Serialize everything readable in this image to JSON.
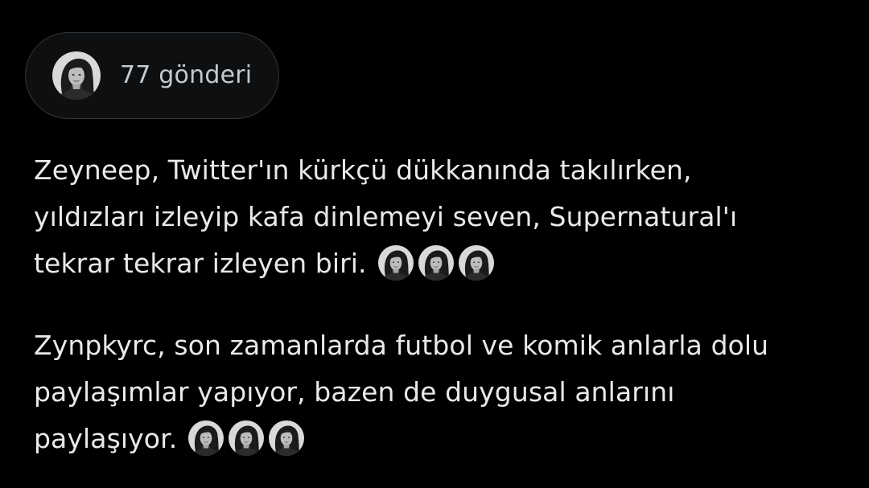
{
  "post_count_pill": {
    "label": "77 gönderi"
  },
  "paragraphs": [
    {
      "lines": [
        "Zeyneep, Twitter'ın kürkçü dükkanında takılırken,",
        "yıldızları izleyip kafa dinlemeyi seven, Supernatural'ı",
        "tekrar tekrar izleyen biri."
      ],
      "trailing_icons": [
        "profile-photo-icon",
        "profile-photo-icon",
        "profile-photo-icon"
      ]
    },
    {
      "lines": [
        "Zynpkyrc, son zamanlarda futbol ve komik anlarla dolu",
        "paylaşımlar yapıyor, bazen de duygusal anlarını",
        "paylaşıyor."
      ],
      "trailing_icons": [
        "profile-photo-icon",
        "profile-photo-icon",
        "profile-photo-icon"
      ]
    }
  ],
  "colors": {
    "background": "#000000",
    "text": "#e7e9ea",
    "pill_border": "#333639",
    "pill_text": "#c4c9cd"
  }
}
